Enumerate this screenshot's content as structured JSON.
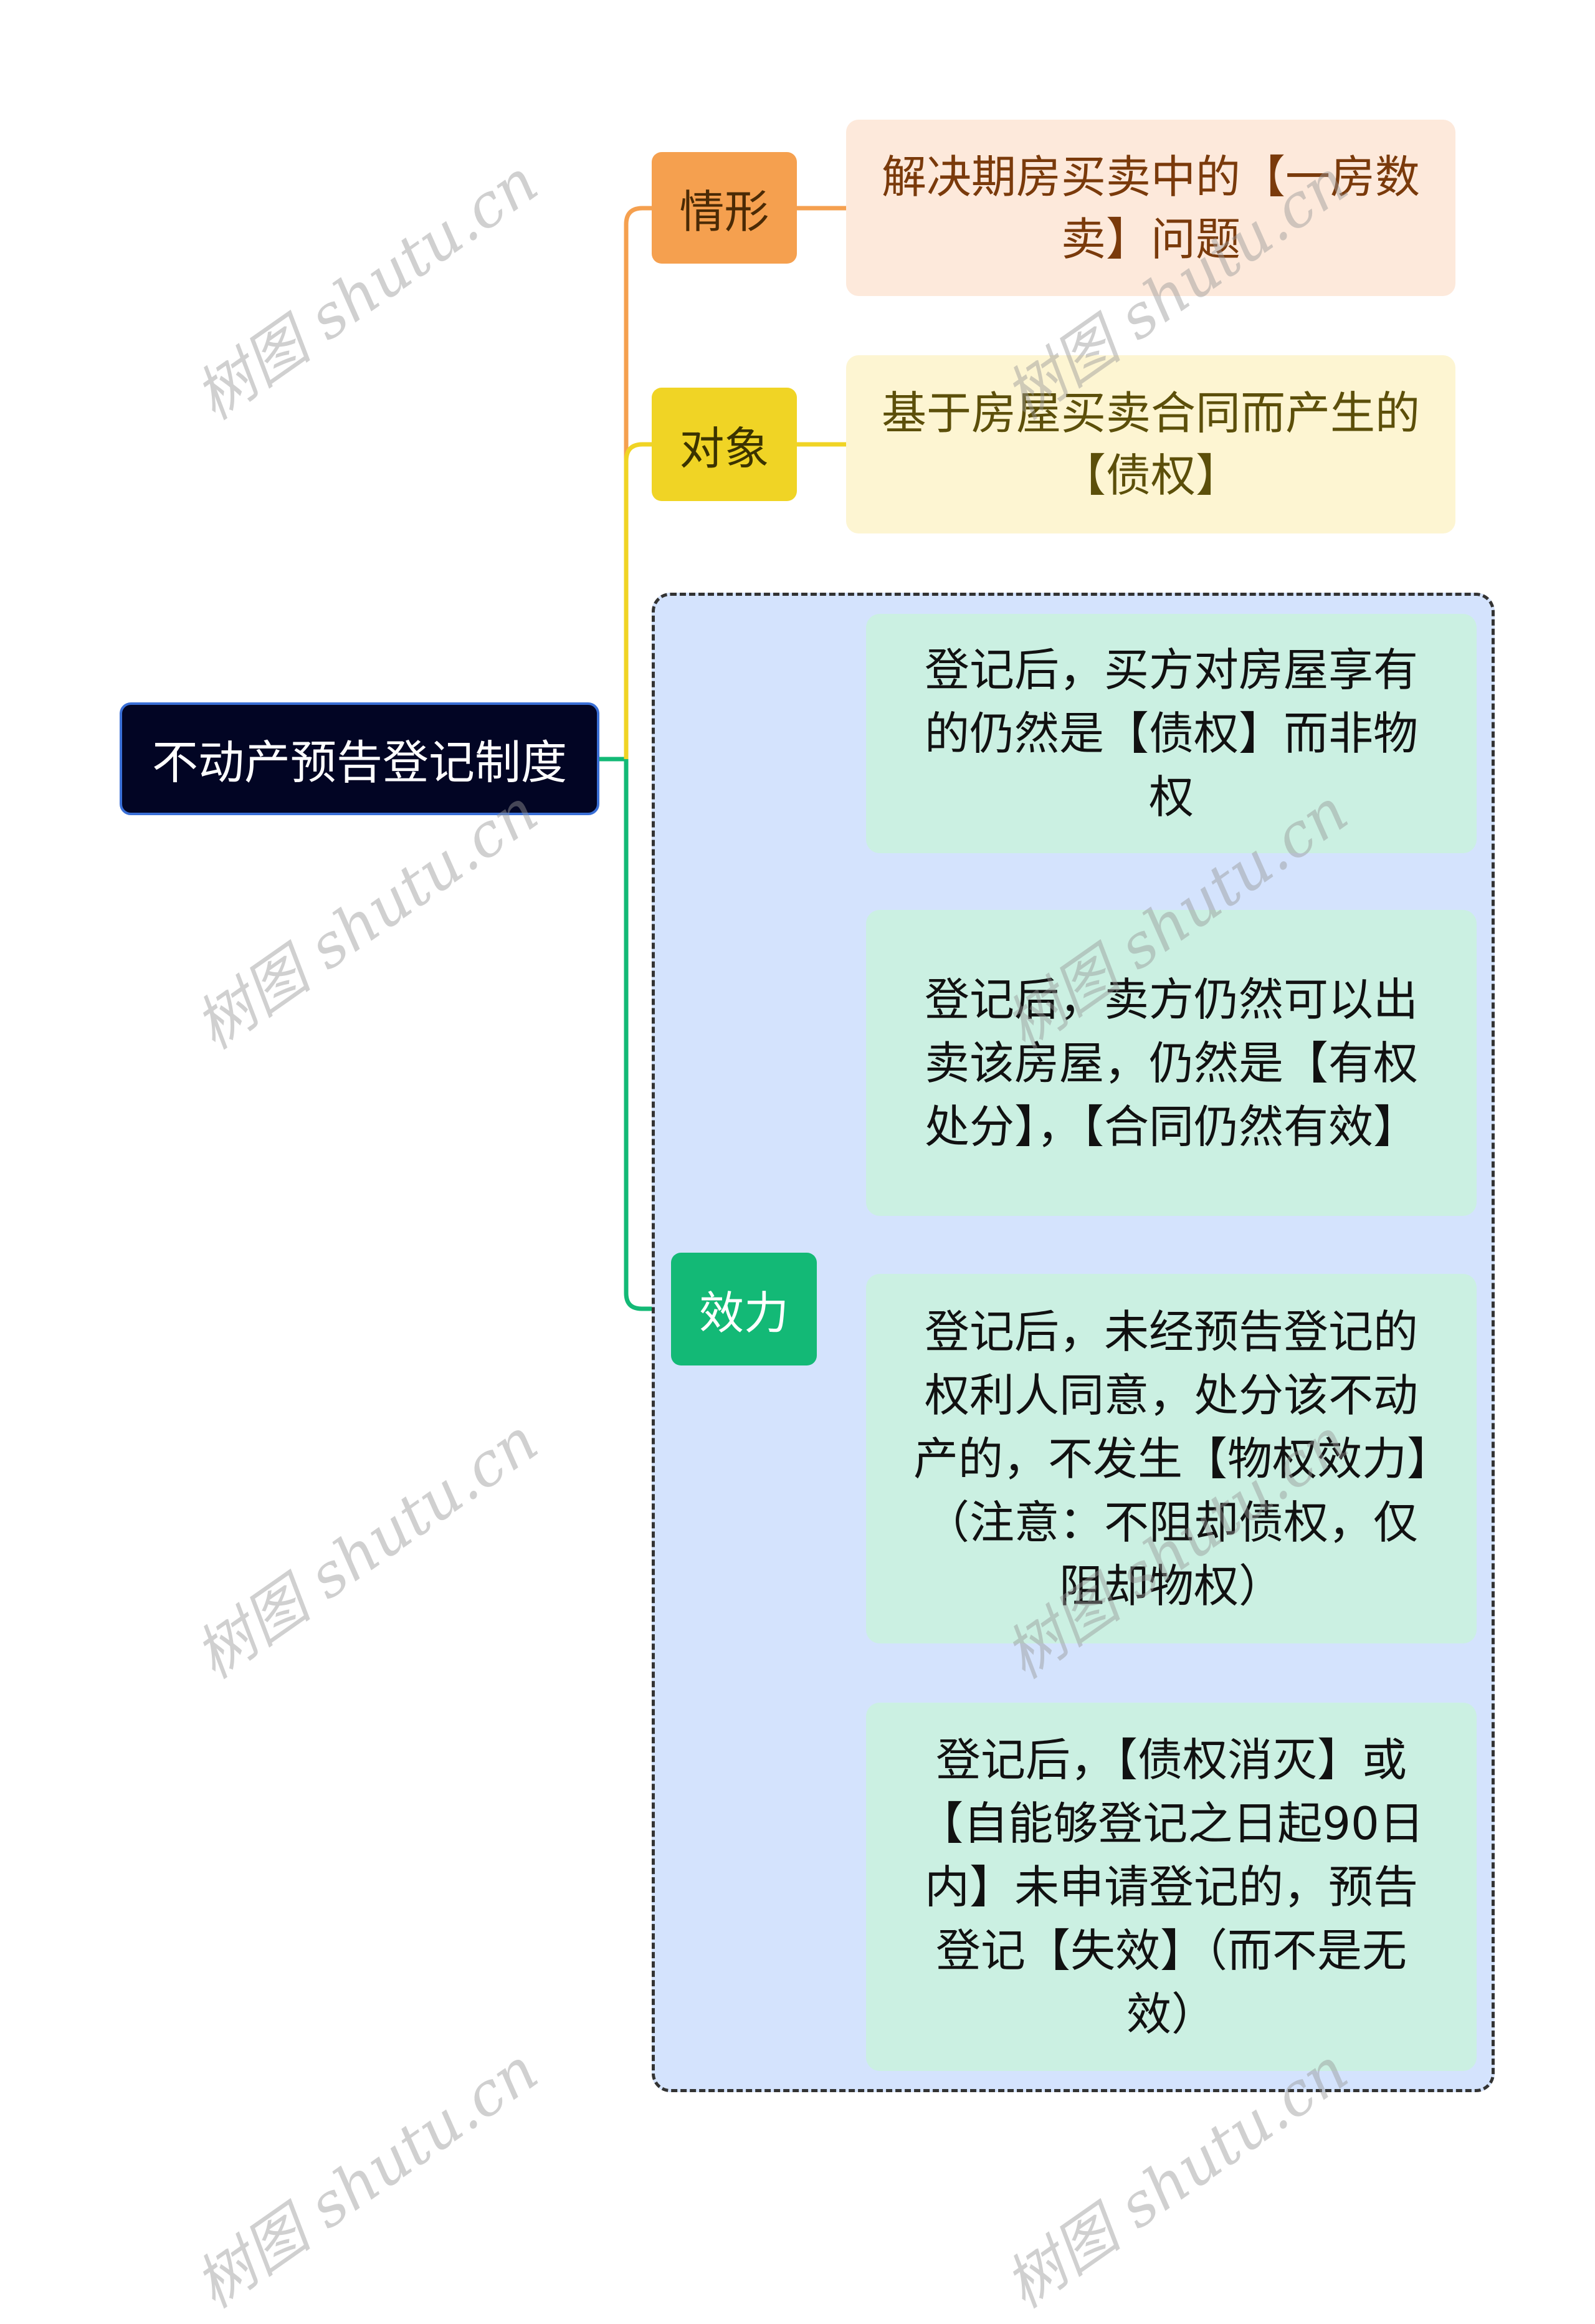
{
  "root": {
    "label": "不动产预告登记制度"
  },
  "branches": [
    {
      "label": "情形",
      "color": "#f5a04f",
      "detail": "解决期房买卖中的【一房数卖】问题"
    },
    {
      "label": "对象",
      "color": "#f0d425",
      "detail": "基于房屋买卖合同而产生的【债权】"
    },
    {
      "label": "效力",
      "color": "#13b976",
      "children": [
        "登记后，买方对房屋享有的仍然是【债权】而非物权",
        "登记后，卖方仍然可以出卖该房屋，仍然是【有权处分】，【合同仍然有效】",
        "登记后，未经预告登记的权利人同意，处分该不动产的，不发生【物权效力】（注意：不阻却债权，仅阻却物权）",
        "登记后，【债权消灭】或【自能够登记之日起90日内】未申请登记的，预告登记【失效】（而不是无效）"
      ]
    }
  ],
  "watermark": "树图 shutu.cn"
}
